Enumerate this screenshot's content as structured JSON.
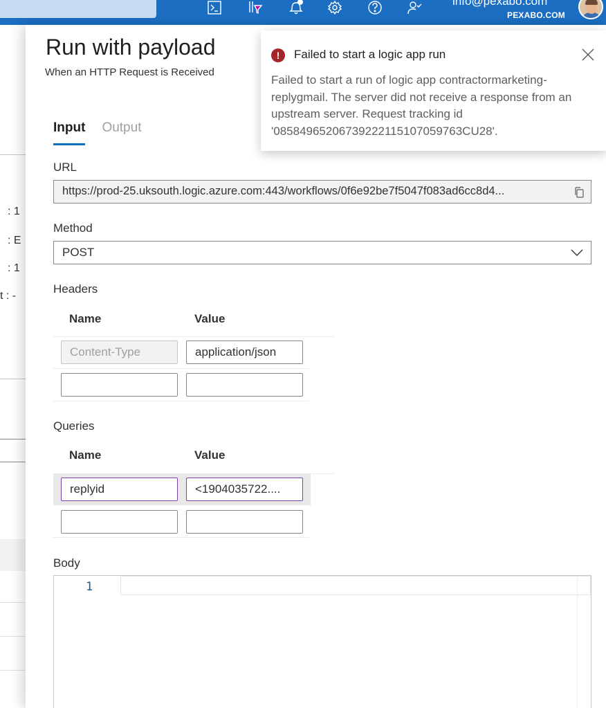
{
  "topbar": {
    "user_email": "info@pexabo.com",
    "user_tenant": "PEXABO.COM",
    "icons": [
      "cloud-shell-icon",
      "directory-filter-icon",
      "notifications-icon",
      "settings-icon",
      "help-icon",
      "feedback-icon"
    ]
  },
  "background": {
    "rows": [
      ": 1",
      ": E",
      ": 1",
      "t : -"
    ]
  },
  "panel": {
    "title": "Run with payload",
    "subtitle": "When an HTTP Request is Received",
    "tabs": [
      {
        "label": "Input",
        "active": true
      },
      {
        "label": "Output",
        "active": false
      }
    ],
    "url_label": "URL",
    "url_value": "https://prod-25.uksouth.logic.azure.com:443/workflows/0f6e92be7f5047f083ad6cc8d4...",
    "method_label": "Method",
    "method_value": "POST",
    "headers_label": "Headers",
    "headers": {
      "col_name": "Name",
      "col_value": "Value",
      "rows": [
        {
          "name": "",
          "name_placeholder": "Content-Type",
          "value": "application/json"
        },
        {
          "name": "",
          "value": ""
        }
      ]
    },
    "queries_label": "Queries",
    "queries": {
      "col_name": "Name",
      "col_value": "Value",
      "rows": [
        {
          "name": "replyid",
          "value": "<1904035722...."
        },
        {
          "name": "",
          "value": ""
        }
      ]
    },
    "body_label": "Body",
    "body_line_number": "1"
  },
  "toast": {
    "title": "Failed to start a logic app run",
    "message": "Failed to start a run of logic app contractormarketing-replygmail. The server did not receive a response from an upstream server. Request tracking id '08584965206739222115107059763CU28'.",
    "icon_glyph": "!",
    "accent_color": "#a4262c"
  }
}
